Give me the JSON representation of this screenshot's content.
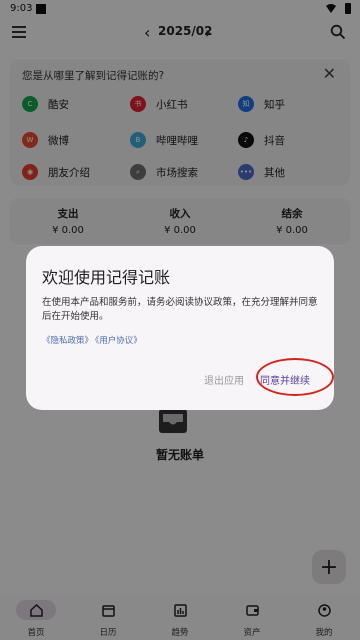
{
  "status": {
    "time": "9:03"
  },
  "header": {
    "prev": "‹",
    "month": "2025/02",
    "next": "›"
  },
  "survey": {
    "question": "您是从哪里了解到记得记账的?",
    "close": "✕",
    "options": [
      {
        "label": "酷安",
        "icon": "coolapk-icon",
        "color": "#16a34a",
        "glyph": "C"
      },
      {
        "label": "小红书",
        "icon": "xiaohongshu-icon",
        "color": "#e11d2e",
        "glyph": "书"
      },
      {
        "label": "知乎",
        "icon": "zhihu-icon",
        "color": "#1d6fe0",
        "glyph": "知"
      },
      {
        "label": "微博",
        "icon": "weibo-icon",
        "color": "#e54b2d",
        "glyph": "W"
      },
      {
        "label": "哔哩哔哩",
        "icon": "bilibili-icon",
        "color": "#3aa7d6",
        "glyph": "B"
      },
      {
        "label": "抖音",
        "icon": "douyin-icon",
        "color": "#111111",
        "glyph": "♪"
      },
      {
        "label": "朋友介绍",
        "icon": "friends-icon",
        "color": "#e23b2f",
        "glyph": "◉"
      },
      {
        "label": "市场搜索",
        "icon": "market-search-icon",
        "color": "#6b6b6b",
        "glyph": "⌕"
      },
      {
        "label": "其他",
        "icon": "more-icon",
        "color": "#4a68c6",
        "glyph": "•••"
      }
    ]
  },
  "summary": {
    "expense_label": "支出",
    "expense_value": "¥ 0.00",
    "income_label": "收入",
    "income_value": "¥ 0.00",
    "balance_label": "结余",
    "balance_value": "¥ 0.00"
  },
  "empty": {
    "text": "暂无账单"
  },
  "fab": {
    "label": "+"
  },
  "nav": {
    "items": [
      {
        "label": "首页",
        "active": true
      },
      {
        "label": "日历"
      },
      {
        "label": "趋势"
      },
      {
        "label": "资产"
      },
      {
        "label": "我的"
      }
    ]
  },
  "dialog": {
    "title": "欢迎使用记得记账",
    "body": "在使用本产品和服务前，请务必阅读协议政策，在充分理解并同意后在开始使用。",
    "privacy_link": "《隐私政策》",
    "user_link": "《用户协议》",
    "exit_label": "退出应用",
    "agree_label": "同意并继续"
  },
  "colors": {
    "accent": "#5a3f9b",
    "highlight": "#d3241c",
    "link": "#4f6fb1"
  }
}
